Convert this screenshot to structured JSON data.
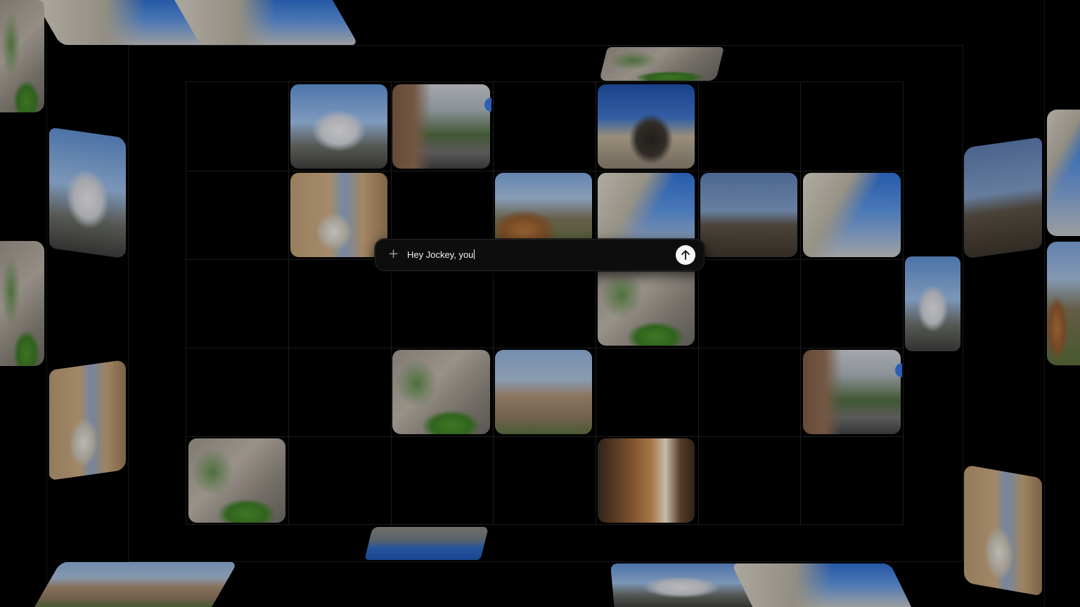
{
  "prompt": {
    "text": "Hey Jockey, you",
    "add_icon": "plus-icon",
    "send_icon": "arrow-up-icon"
  },
  "grid": {
    "columns": 7,
    "rows": 5
  },
  "tiles": [
    {
      "cell": "r1c2",
      "photo": "palace"
    },
    {
      "cell": "r1c3",
      "photo": "street"
    },
    {
      "cell": "r1c5",
      "photo": "lion"
    },
    {
      "cell": "r2c2",
      "photo": "carriage"
    },
    {
      "cell": "r2c4",
      "photo": "park"
    },
    {
      "cell": "r2c5",
      "photo": "cathedral"
    },
    {
      "cell": "r2c6",
      "photo": "skyline"
    },
    {
      "cell": "r2c7",
      "photo": "cathedral"
    },
    {
      "cell": "r3c5",
      "photo": "aerial"
    },
    {
      "cell": "r4c3",
      "photo": "aerial"
    },
    {
      "cell": "r4c4",
      "photo": "town"
    },
    {
      "cell": "r4c7",
      "photo": "street"
    },
    {
      "cell": "r5c1",
      "photo": "aerial"
    },
    {
      "cell": "r5c5",
      "photo": "plaza"
    }
  ],
  "colors": {
    "background": "#000000",
    "grid_line": "#1c1c1c",
    "prompt_bg": "#0d0d0d",
    "send_button": "#f5f5f5",
    "marker": "#2b5fb8"
  }
}
